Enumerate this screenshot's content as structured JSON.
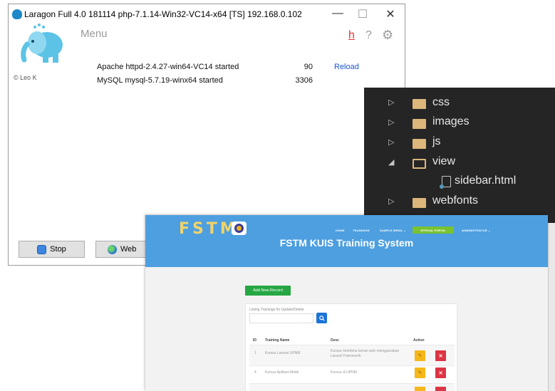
{
  "laragon": {
    "title": "Laragon Full 4.0 181114 php-7.1.14-Win32-VC14-x64 [TS] 192.168.0.102",
    "menu_label": "Menu",
    "h_icon": "h",
    "help_icon": "?",
    "author": "© Leo K",
    "services": [
      {
        "name": "Apache httpd-2.4.27-win64-VC14 started",
        "port": "90",
        "action": "Reload"
      },
      {
        "name": "MySQL mysql-5.7.19-winx64 started",
        "port": "3306",
        "action": ""
      }
    ],
    "buttons": {
      "stop": "Stop",
      "web": "Web"
    },
    "window_controls": {
      "minimize": "—",
      "maximize": "☐",
      "close": "✕"
    },
    "colors": {
      "accent": "#1e88c8",
      "reload_link": "#1a55d8",
      "h_icon": "#e3373a"
    }
  },
  "file_tree": {
    "items": [
      {
        "name": "css",
        "type": "folder",
        "expanded": false
      },
      {
        "name": "images",
        "type": "folder",
        "expanded": false
      },
      {
        "name": "js",
        "type": "folder",
        "expanded": false
      },
      {
        "name": "view",
        "type": "folder",
        "expanded": true
      },
      {
        "name": "sidebar.html",
        "type": "file"
      },
      {
        "name": "webfonts",
        "type": "folder",
        "expanded": false
      }
    ],
    "colors": {
      "background": "#252526",
      "folder": "#dcb67a"
    }
  },
  "browser": {
    "brand": "FSTM",
    "nav": {
      "home": "HOME",
      "trainings": "TRAININGS",
      "sample_menu": "SAMPLE MENU ⌄",
      "official_portal": "OFFICIAL PORTAL",
      "administrator": "ADMINISTRATOR ⌄"
    },
    "hero_title": "FSTM KUIS Training System",
    "add_button": "Add New Record",
    "card_heading": "Listing Trainings for Update/Delete",
    "search_icon": "search-icon",
    "table": {
      "headers": [
        "ID",
        "Training Name",
        "Desc",
        "Action"
      ],
      "rows": [
        {
          "id": "1",
          "name": "Kursus Laravel UPNM",
          "desc": "Kursus membina laman web menggunakan Laravel Framework"
        },
        {
          "id": "4",
          "name": "Kursus Aplikasi Mobil",
          "desc": "Kursus di UPNM"
        }
      ]
    },
    "colors": {
      "hero": "#4d9fe0",
      "add_button": "#27a743",
      "edit": "#f5b719",
      "delete": "#dc3545",
      "portal": "#79c231"
    }
  }
}
